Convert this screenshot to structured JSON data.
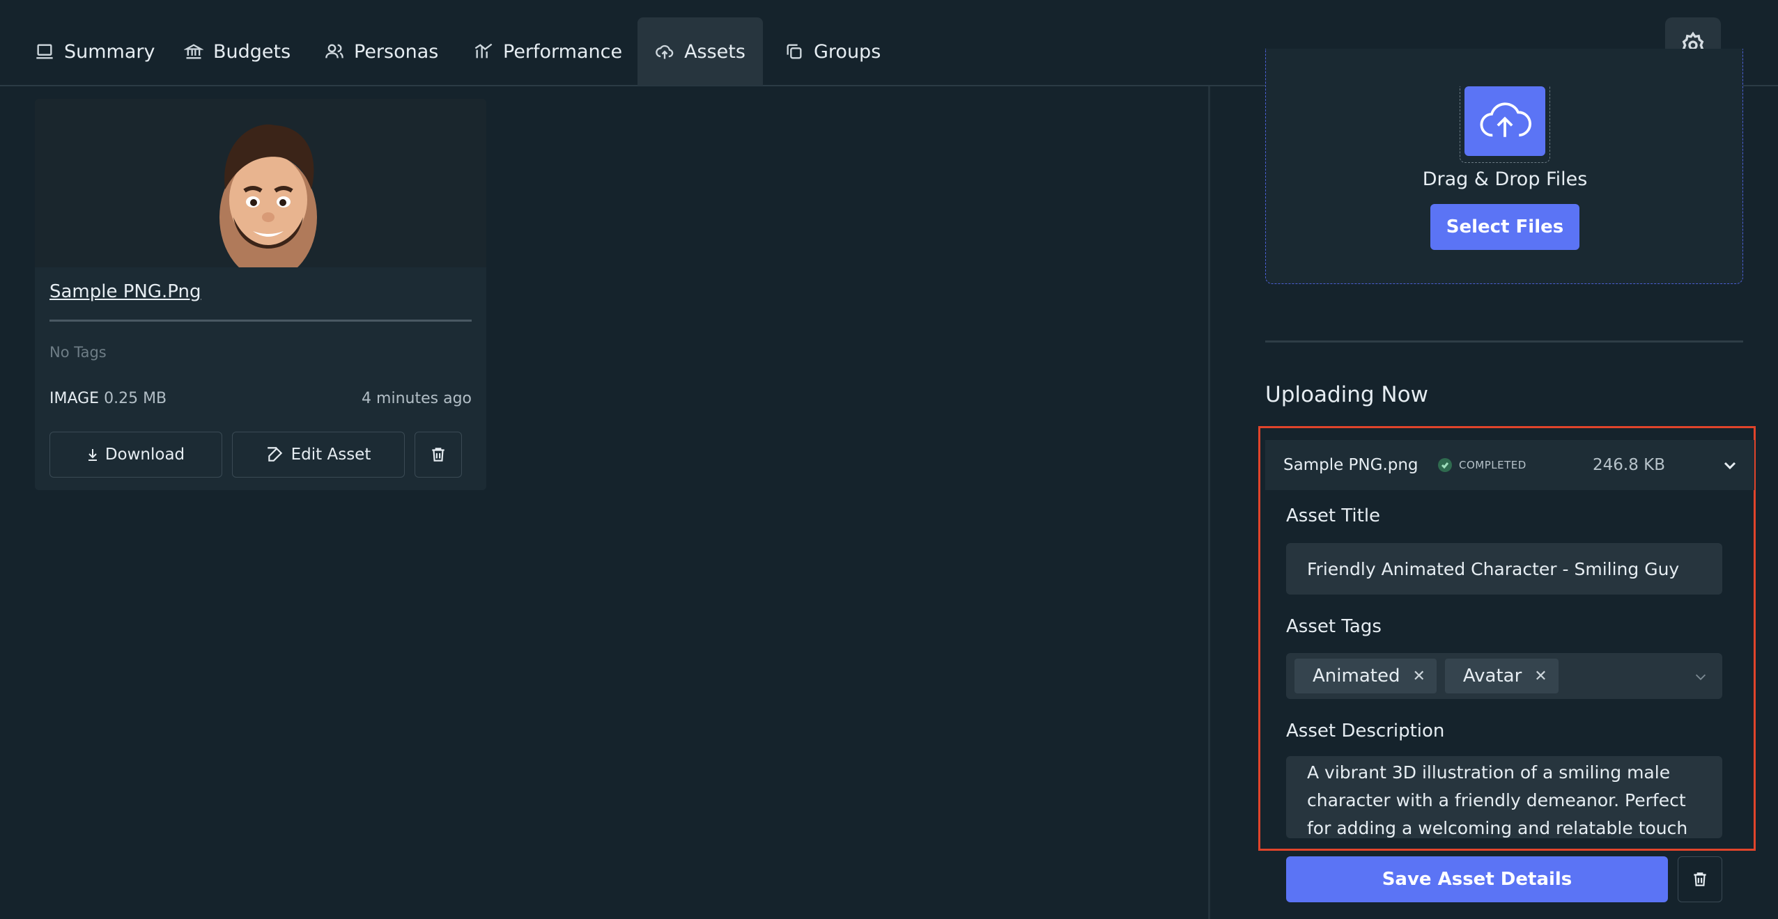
{
  "nav": {
    "tabs": [
      {
        "label": "Summary",
        "icon": "laptop-icon"
      },
      {
        "label": "Budgets",
        "icon": "bank-icon"
      },
      {
        "label": "Personas",
        "icon": "users-icon"
      },
      {
        "label": "Performance",
        "icon": "chart-icon"
      },
      {
        "label": "Assets",
        "icon": "cloud-upload-icon",
        "active": true
      },
      {
        "label": "Groups",
        "icon": "copy-icon"
      }
    ],
    "settings_icon": "gear-icon"
  },
  "asset_card": {
    "title": "Sample PNG.Png",
    "tags_text": "No Tags",
    "type": "IMAGE",
    "size": "0.25 MB",
    "time": "4 minutes ago",
    "download_label": "Download",
    "edit_label": "Edit Asset"
  },
  "dropzone": {
    "label": "Drag & Drop Files",
    "button_label": "Select Files"
  },
  "uploading": {
    "title": "Uploading Now",
    "file": {
      "name": "Sample PNG.png",
      "status": "COMPLETED",
      "size": "246.8 KB"
    },
    "form": {
      "title_label": "Asset Title",
      "title_value": "Friendly Animated Character - Smiling Guy",
      "tags_label": "Asset Tags",
      "tags": [
        "Animated",
        "Avatar"
      ],
      "description_label": "Asset Description",
      "description_value": "A vibrant 3D illustration of a smiling male character with a friendly demeanor. Perfect for adding a welcoming and relatable touch to",
      "save_label": "Save Asset Details"
    }
  },
  "colors": {
    "background": "#15232c",
    "accent": "#5b74f5",
    "highlight": "#e0442b"
  }
}
